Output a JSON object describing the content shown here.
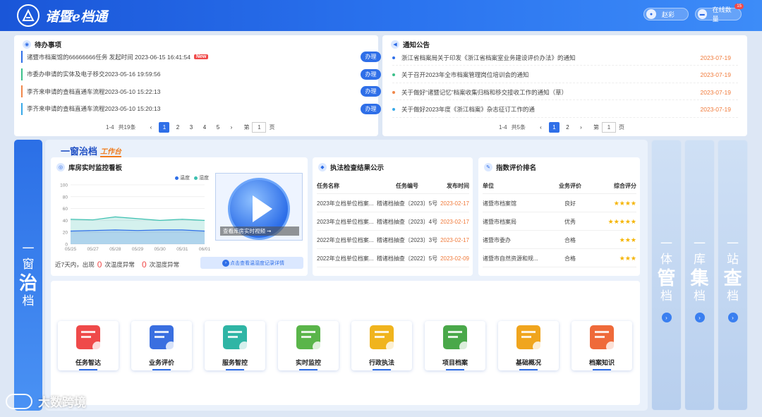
{
  "header": {
    "app_title": "诸暨e档通",
    "user_label": "赵彩",
    "online_label": "在线数量",
    "online_count": "15"
  },
  "todo": {
    "title": "待办事项",
    "items": [
      {
        "text": "诸暨市档案馆的66666666任务 发起时间 2023-06-15 16:41:54",
        "is_new": true,
        "new_label": "New",
        "action": "办理",
        "color": "#2f6fe8"
      },
      {
        "text": "市委办申请的实体及电子移交2023-05-16 19:59:56",
        "is_new": false,
        "action": "办理",
        "color": "#3cc08a"
      },
      {
        "text": "李齐来申请的查档直通车流程2023-05-10 15:22:13",
        "is_new": false,
        "action": "办理",
        "color": "#f0874a"
      },
      {
        "text": "李齐来申请的查档直通车流程2023-05-10 15:20:13",
        "is_new": false,
        "action": "办理",
        "color": "#38a9e8"
      }
    ],
    "pager": {
      "range": "1-4",
      "total": "共19条",
      "pages": [
        "1",
        "2",
        "3",
        "4",
        "5"
      ],
      "active": "1",
      "goto_prefix": "第",
      "goto_value": "1",
      "goto_suffix": "页"
    }
  },
  "notice": {
    "title": "通知公告",
    "items": [
      {
        "text": "浙江省档案局关于印发《浙江省档案室业务建设评价办法》的通知",
        "date": "2023-07-19",
        "color": "#2f6fe8"
      },
      {
        "text": "关于召开2023年全市档案管理岗位培训会的通知",
        "date": "2023-07-19",
        "color": "#3cc08a"
      },
      {
        "text": "关于做好“诸暨记忆”档案收集归档和移交接收工作的通知（草）",
        "date": "2023-07-19",
        "color": "#f0874a"
      },
      {
        "text": "关于做好2023年度《浙江档案》杂志征订工作的通",
        "date": "2023-07-19",
        "color": "#38a9e8"
      }
    ],
    "pager": {
      "range": "1-4",
      "total": "共5条",
      "pages": [
        "1",
        "2"
      ],
      "active": "1",
      "goto_prefix": "第",
      "goto_value": "1",
      "goto_suffix": "页"
    }
  },
  "left_panel": {
    "chars": [
      "一",
      "窗",
      "治",
      "档"
    ]
  },
  "right_panels": [
    {
      "chars": [
        "一",
        "体",
        "管",
        "档"
      ]
    },
    {
      "chars": [
        "一",
        "库",
        "集",
        "档"
      ]
    },
    {
      "chars": [
        "一",
        "站",
        "查",
        "档"
      ]
    }
  ],
  "center": {
    "banner_title": "一窗治档",
    "banner_tag": "工作台"
  },
  "monitor": {
    "title": "库房实时监控看板",
    "legend": [
      {
        "name": "温度",
        "color": "#2f6fe8"
      },
      {
        "name": "湿度",
        "color": "#3cc0b0"
      }
    ],
    "video_caption": "查看库房实时视频 ➞",
    "stat_prefix": "近7天内，出现",
    "temp_count": "0",
    "temp_label": "次温度异常",
    "humid_count": "0",
    "humid_label": "次湿度异常",
    "detail_link": "点击查看温湿度记录详情"
  },
  "chart_data": {
    "type": "area",
    "x": [
      "05/25",
      "05/27",
      "05/28",
      "05/29",
      "05/30",
      "05/31",
      "06/01"
    ],
    "yticks": [
      "0",
      "20",
      "40",
      "60",
      "80",
      "100"
    ],
    "ylim": [
      0,
      100
    ],
    "series": [
      {
        "name": "温度",
        "values": [
          22,
          23,
          24,
          23,
          24,
          24,
          22
        ],
        "color": "#2f6fe8"
      },
      {
        "name": "湿度",
        "values": [
          42,
          41,
          46,
          43,
          40,
          42,
          40
        ],
        "color": "#3cc0b0"
      }
    ],
    "legend": "top-right",
    "grid": true
  },
  "inspection": {
    "title": "执法检查结果公示",
    "headers": [
      "任务名称",
      "任务编号",
      "发布时间"
    ],
    "rows": [
      [
        "2023年立档单位档案...",
        "稽诸档抽查〔2023〕5号",
        "2023-02-17"
      ],
      [
        "2023年立档单位档案...",
        "稽诸档抽查〔2023〕4号",
        "2023-02-17"
      ],
      [
        "2022年立档单位档案...",
        "稽诸档抽查〔2023〕3号",
        "2023-02-17"
      ],
      [
        "2022年立档单位档案...",
        "稽诸档抽查〔2022〕5号",
        "2023-02-09"
      ]
    ]
  },
  "ranking": {
    "title": "指数评价排名",
    "headers": [
      "单位",
      "业务评价",
      "综合评分"
    ],
    "rows": [
      {
        "unit": "诸暨市档案馆",
        "grade": "良好",
        "stars": "★★★★"
      },
      {
        "unit": "诸暨市档案局",
        "grade": "优秀",
        "stars": "★★★★★"
      },
      {
        "unit": "诸暨市委办",
        "grade": "合格",
        "stars": "★★★"
      },
      {
        "unit": "诸暨市自然资源和规...",
        "grade": "合格",
        "stars": "★★★"
      }
    ]
  },
  "modules": [
    {
      "label": "任务智达",
      "icon": "task-inbox-icon",
      "color": "#ef4a4a"
    },
    {
      "label": "业务评价",
      "icon": "folder-rating-icon",
      "color": "#3a6fe0"
    },
    {
      "label": "服务智控",
      "icon": "monitor-pulse-icon",
      "color": "#2fb5a5"
    },
    {
      "label": "实时监控",
      "icon": "camera-icon",
      "color": "#5ab54a"
    },
    {
      "label": "行政执法",
      "icon": "shield-icon",
      "color": "#f0b41e"
    },
    {
      "label": "项目档案",
      "icon": "binders-icon",
      "color": "#4aa84a"
    },
    {
      "label": "基础概况",
      "icon": "calendar-icon",
      "color": "#f0a51e"
    },
    {
      "label": "档案知识",
      "icon": "knowledge-board-icon",
      "color": "#ef6a3a"
    }
  ],
  "watermark": {
    "text": "大数跨境"
  }
}
